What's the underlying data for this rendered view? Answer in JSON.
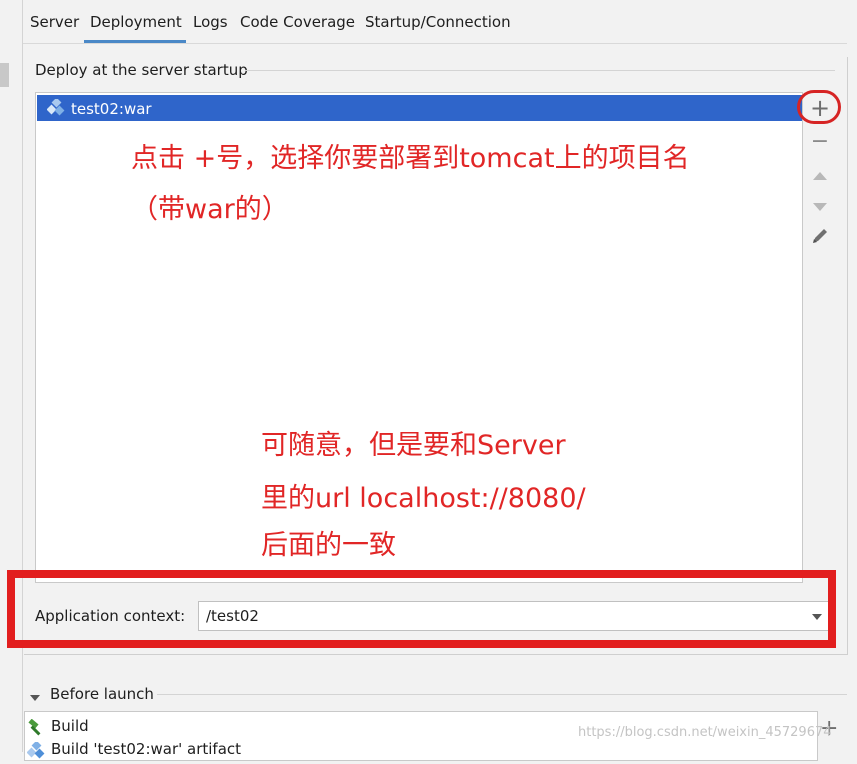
{
  "tabs": [
    {
      "label": "Server"
    },
    {
      "label": "Deployment"
    },
    {
      "label": "Logs"
    },
    {
      "label": "Code Coverage"
    },
    {
      "label": "Startup/Connection"
    }
  ],
  "active_tab": "Deployment",
  "deploy_group": {
    "title": "Deploy at the server startup",
    "items": [
      {
        "label": "test02:war",
        "icon": "artifact-war-icon",
        "selected": true
      }
    ]
  },
  "toolbar": {
    "add": {
      "glyph": "+",
      "icon": "plus-icon"
    },
    "remove": {
      "glyph": "−",
      "icon": "minus-icon"
    },
    "move_up": {
      "icon": "move-up-icon"
    },
    "move_down": {
      "icon": "move-down-icon"
    },
    "edit": {
      "icon": "pencil-icon"
    }
  },
  "annotations": {
    "line1": "点击 +号，选择你要部署到tomcat上的项目名",
    "line2": "（带war的）",
    "line3": "可随意，但是要和Server",
    "line4": "里的url localhost://8080/",
    "line5": "后面的一致"
  },
  "application_context": {
    "label": "Application context:",
    "value": "/test02"
  },
  "before_launch": {
    "title": "Before launch",
    "items": [
      {
        "label": "Build",
        "icon": "hammer-icon"
      },
      {
        "label": "Build 'test02:war' artifact",
        "icon": "artifact-war-icon"
      }
    ],
    "add_glyph": "+"
  },
  "watermark": "https://blog.csdn.net/weixin_45729674",
  "colors": {
    "selection": "#2f65ca",
    "accent_underline": "#4a88c7",
    "annotation_red": "#e12626",
    "background": "#f2f2f2"
  }
}
